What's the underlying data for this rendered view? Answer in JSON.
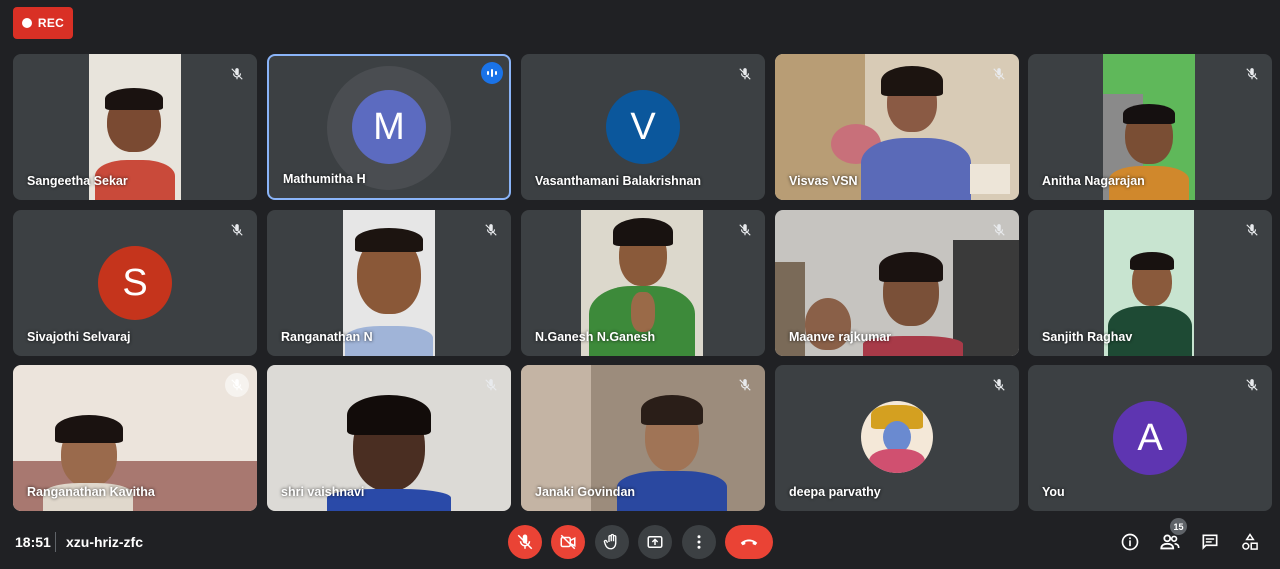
{
  "recording": {
    "label": "REC",
    "color": "#d93025"
  },
  "meeting": {
    "time": "18:51",
    "code": "xzu-hriz-zfc"
  },
  "participants": [
    {
      "name": "Sangeetha Sekar",
      "type": "video",
      "muted": true
    },
    {
      "name": "Mathumitha H",
      "type": "avatar",
      "initial": "M",
      "avatar_color": "#5c6bc0",
      "speaking": true
    },
    {
      "name": "Vasanthamani Balakrishnan",
      "type": "avatar",
      "initial": "V",
      "avatar_color": "#0b579c",
      "muted": true
    },
    {
      "name": "Visvas VSN",
      "type": "video",
      "muted": true
    },
    {
      "name": "Anitha Nagarajan",
      "type": "video",
      "muted": true
    },
    {
      "name": "Sivajothi Selvaraj",
      "type": "avatar",
      "initial": "S",
      "avatar_color": "#c5341c",
      "muted": true
    },
    {
      "name": "Ranganathan N",
      "type": "video",
      "muted": true
    },
    {
      "name": "N.Ganesh N.Ganesh",
      "type": "video",
      "muted": true
    },
    {
      "name": "Maanve rajkumar",
      "type": "video",
      "muted": true
    },
    {
      "name": "Sanjith Raghav",
      "type": "video",
      "muted": true
    },
    {
      "name": "Ranganathan Kavitha",
      "type": "video",
      "muted": true
    },
    {
      "name": "shri vaishnavi",
      "type": "video",
      "muted": true
    },
    {
      "name": "Janaki Govindan",
      "type": "video",
      "muted": true
    },
    {
      "name": "deepa parvathy",
      "type": "image",
      "muted": true
    },
    {
      "name": "You",
      "type": "avatar",
      "initial": "A",
      "avatar_color": "#5e35b1",
      "muted": true
    }
  ],
  "controls": {
    "mic": "mic-off-icon",
    "camera": "camera-off-icon",
    "raise_hand": "hand-icon",
    "present": "present-icon",
    "more": "more-vert-icon",
    "hangup": "call-end-icon"
  },
  "right_controls": {
    "info": "info-icon",
    "people": "people-icon",
    "people_count": "15",
    "chat": "chat-icon",
    "activities": "activities-icon"
  }
}
